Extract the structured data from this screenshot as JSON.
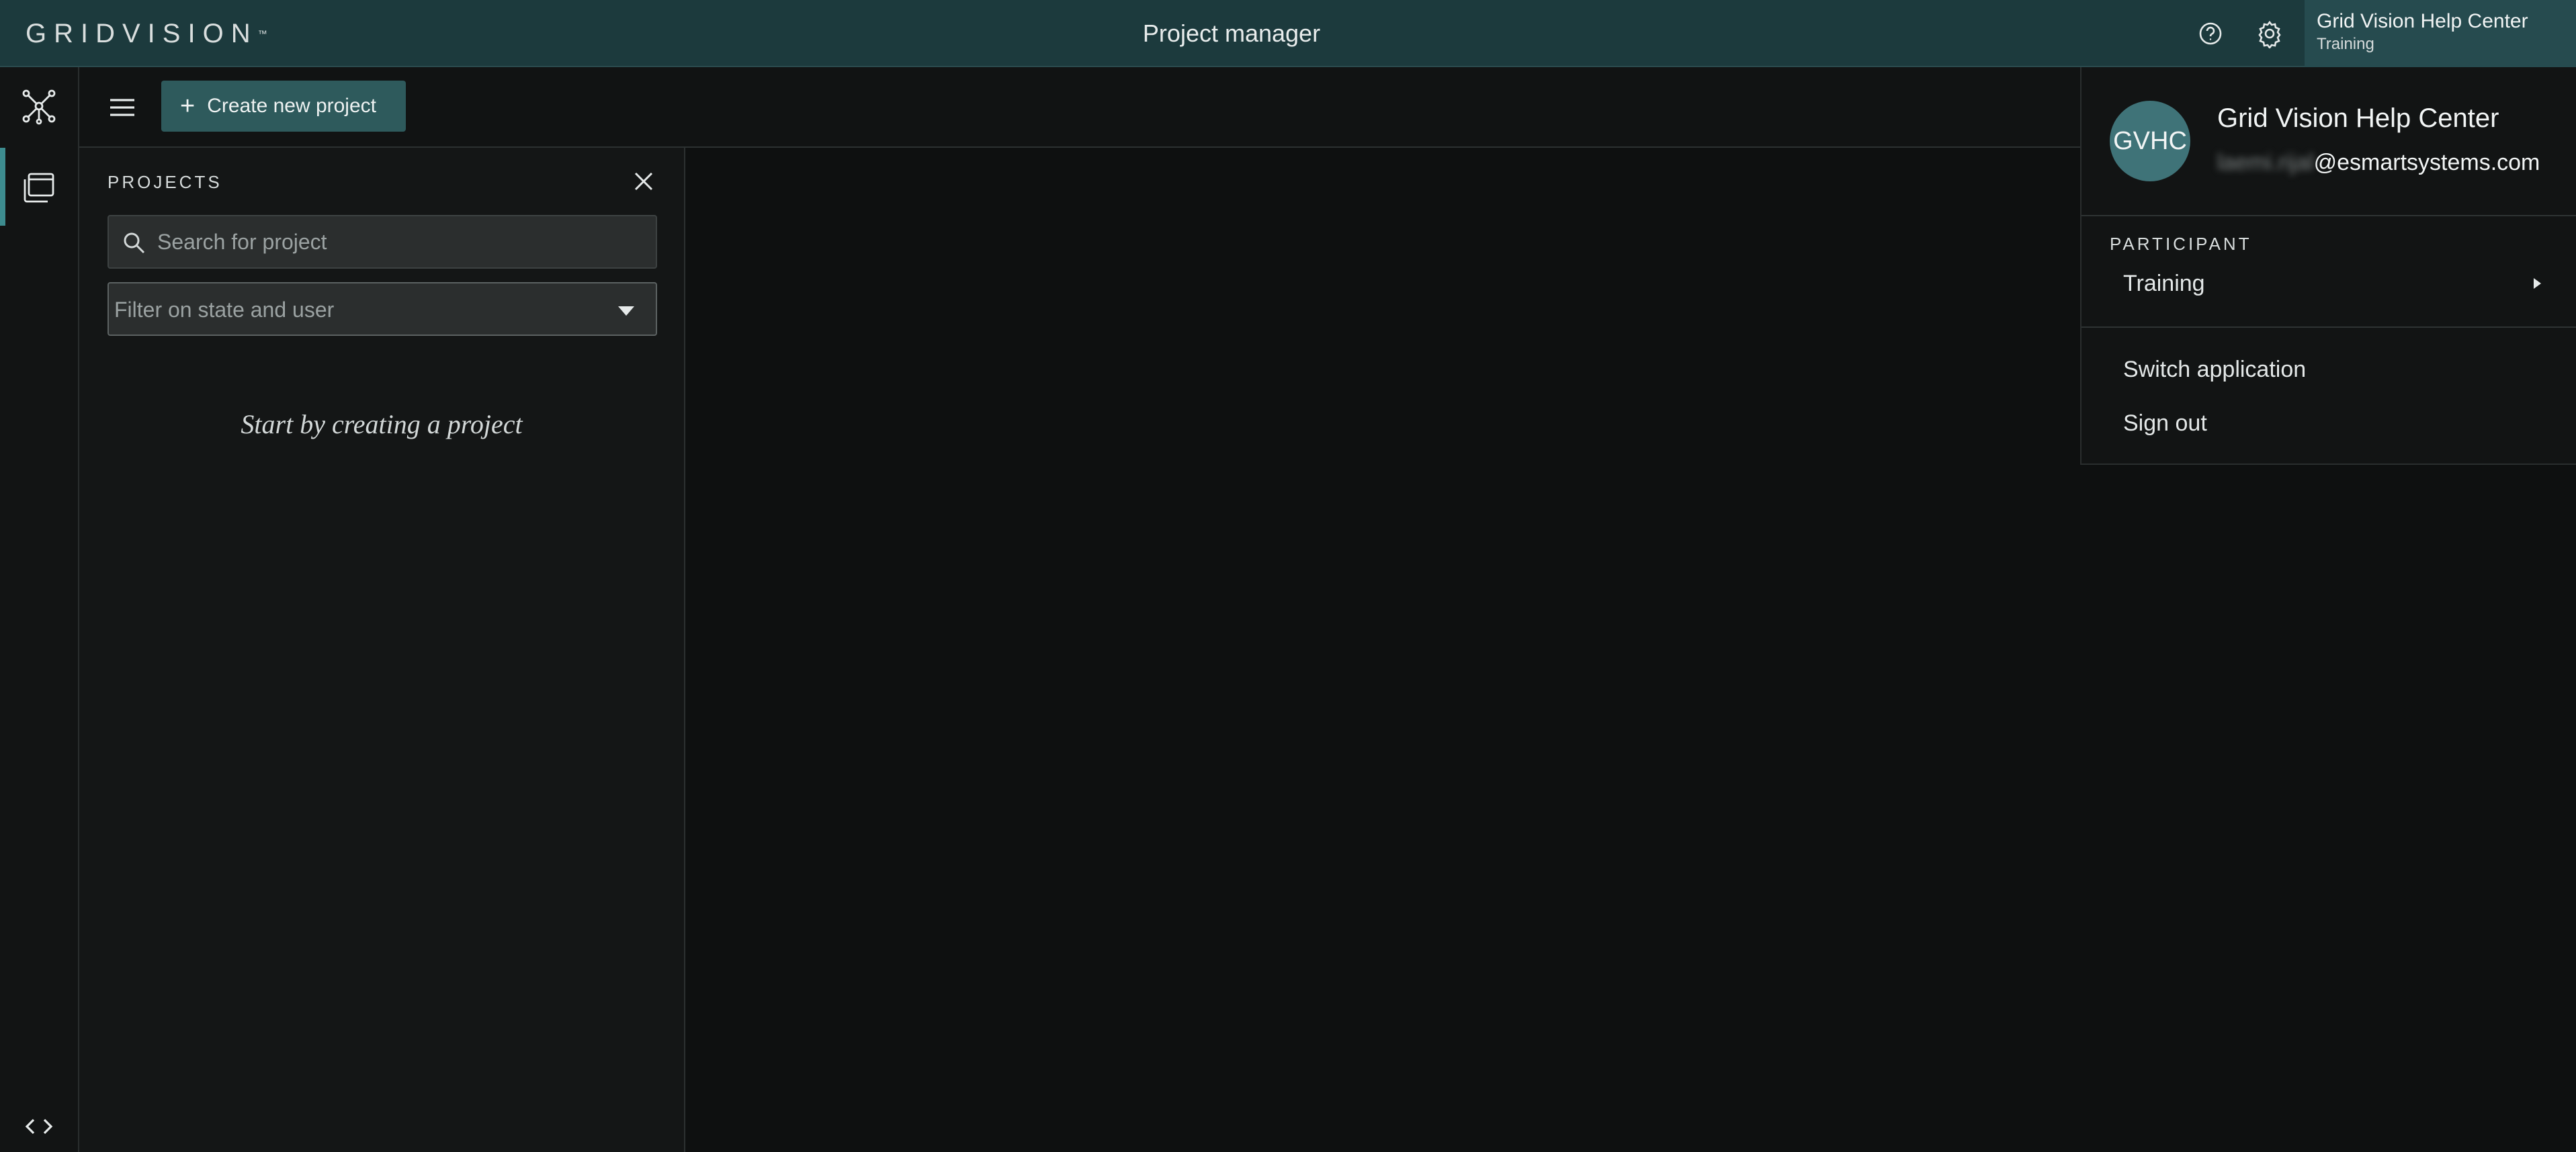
{
  "header": {
    "logo_text": "GRIDVISION",
    "logo_mark": "™",
    "title": "Project manager",
    "help_icon": "help-circle-icon",
    "settings_icon": "gear-icon",
    "user": {
      "name": "Grid Vision Help Center",
      "subtitle": "Training"
    }
  },
  "rail": {
    "items": [
      {
        "icon": "network-icon"
      },
      {
        "icon": "projects-icon",
        "active": true
      }
    ],
    "collapse_icon": "code-brackets-icon"
  },
  "toolbar": {
    "menu_icon": "hamburger-icon",
    "create_plus": "+",
    "create_label": "Create new project"
  },
  "projects_panel": {
    "title": "PROJECTS",
    "search_placeholder": "Search for project",
    "filter_placeholder": "Filter on state and user",
    "empty_message": "Start by creating a project"
  },
  "account_menu": {
    "avatar_initials": "GVHC",
    "name": "Grid Vision Help Center",
    "email_hidden": "laemi.rijal",
    "email_domain": "@esmartsystems.com",
    "section_label": "PARTICIPANT",
    "participant_item": "Training",
    "switch_application": "Switch application",
    "sign_out": "Sign out"
  },
  "colors": {
    "topbar": "#1c3a3d",
    "accent": "#3d8c8f",
    "button": "#2e5a5c",
    "avatar": "#3f7378",
    "background": "#0f1111"
  }
}
